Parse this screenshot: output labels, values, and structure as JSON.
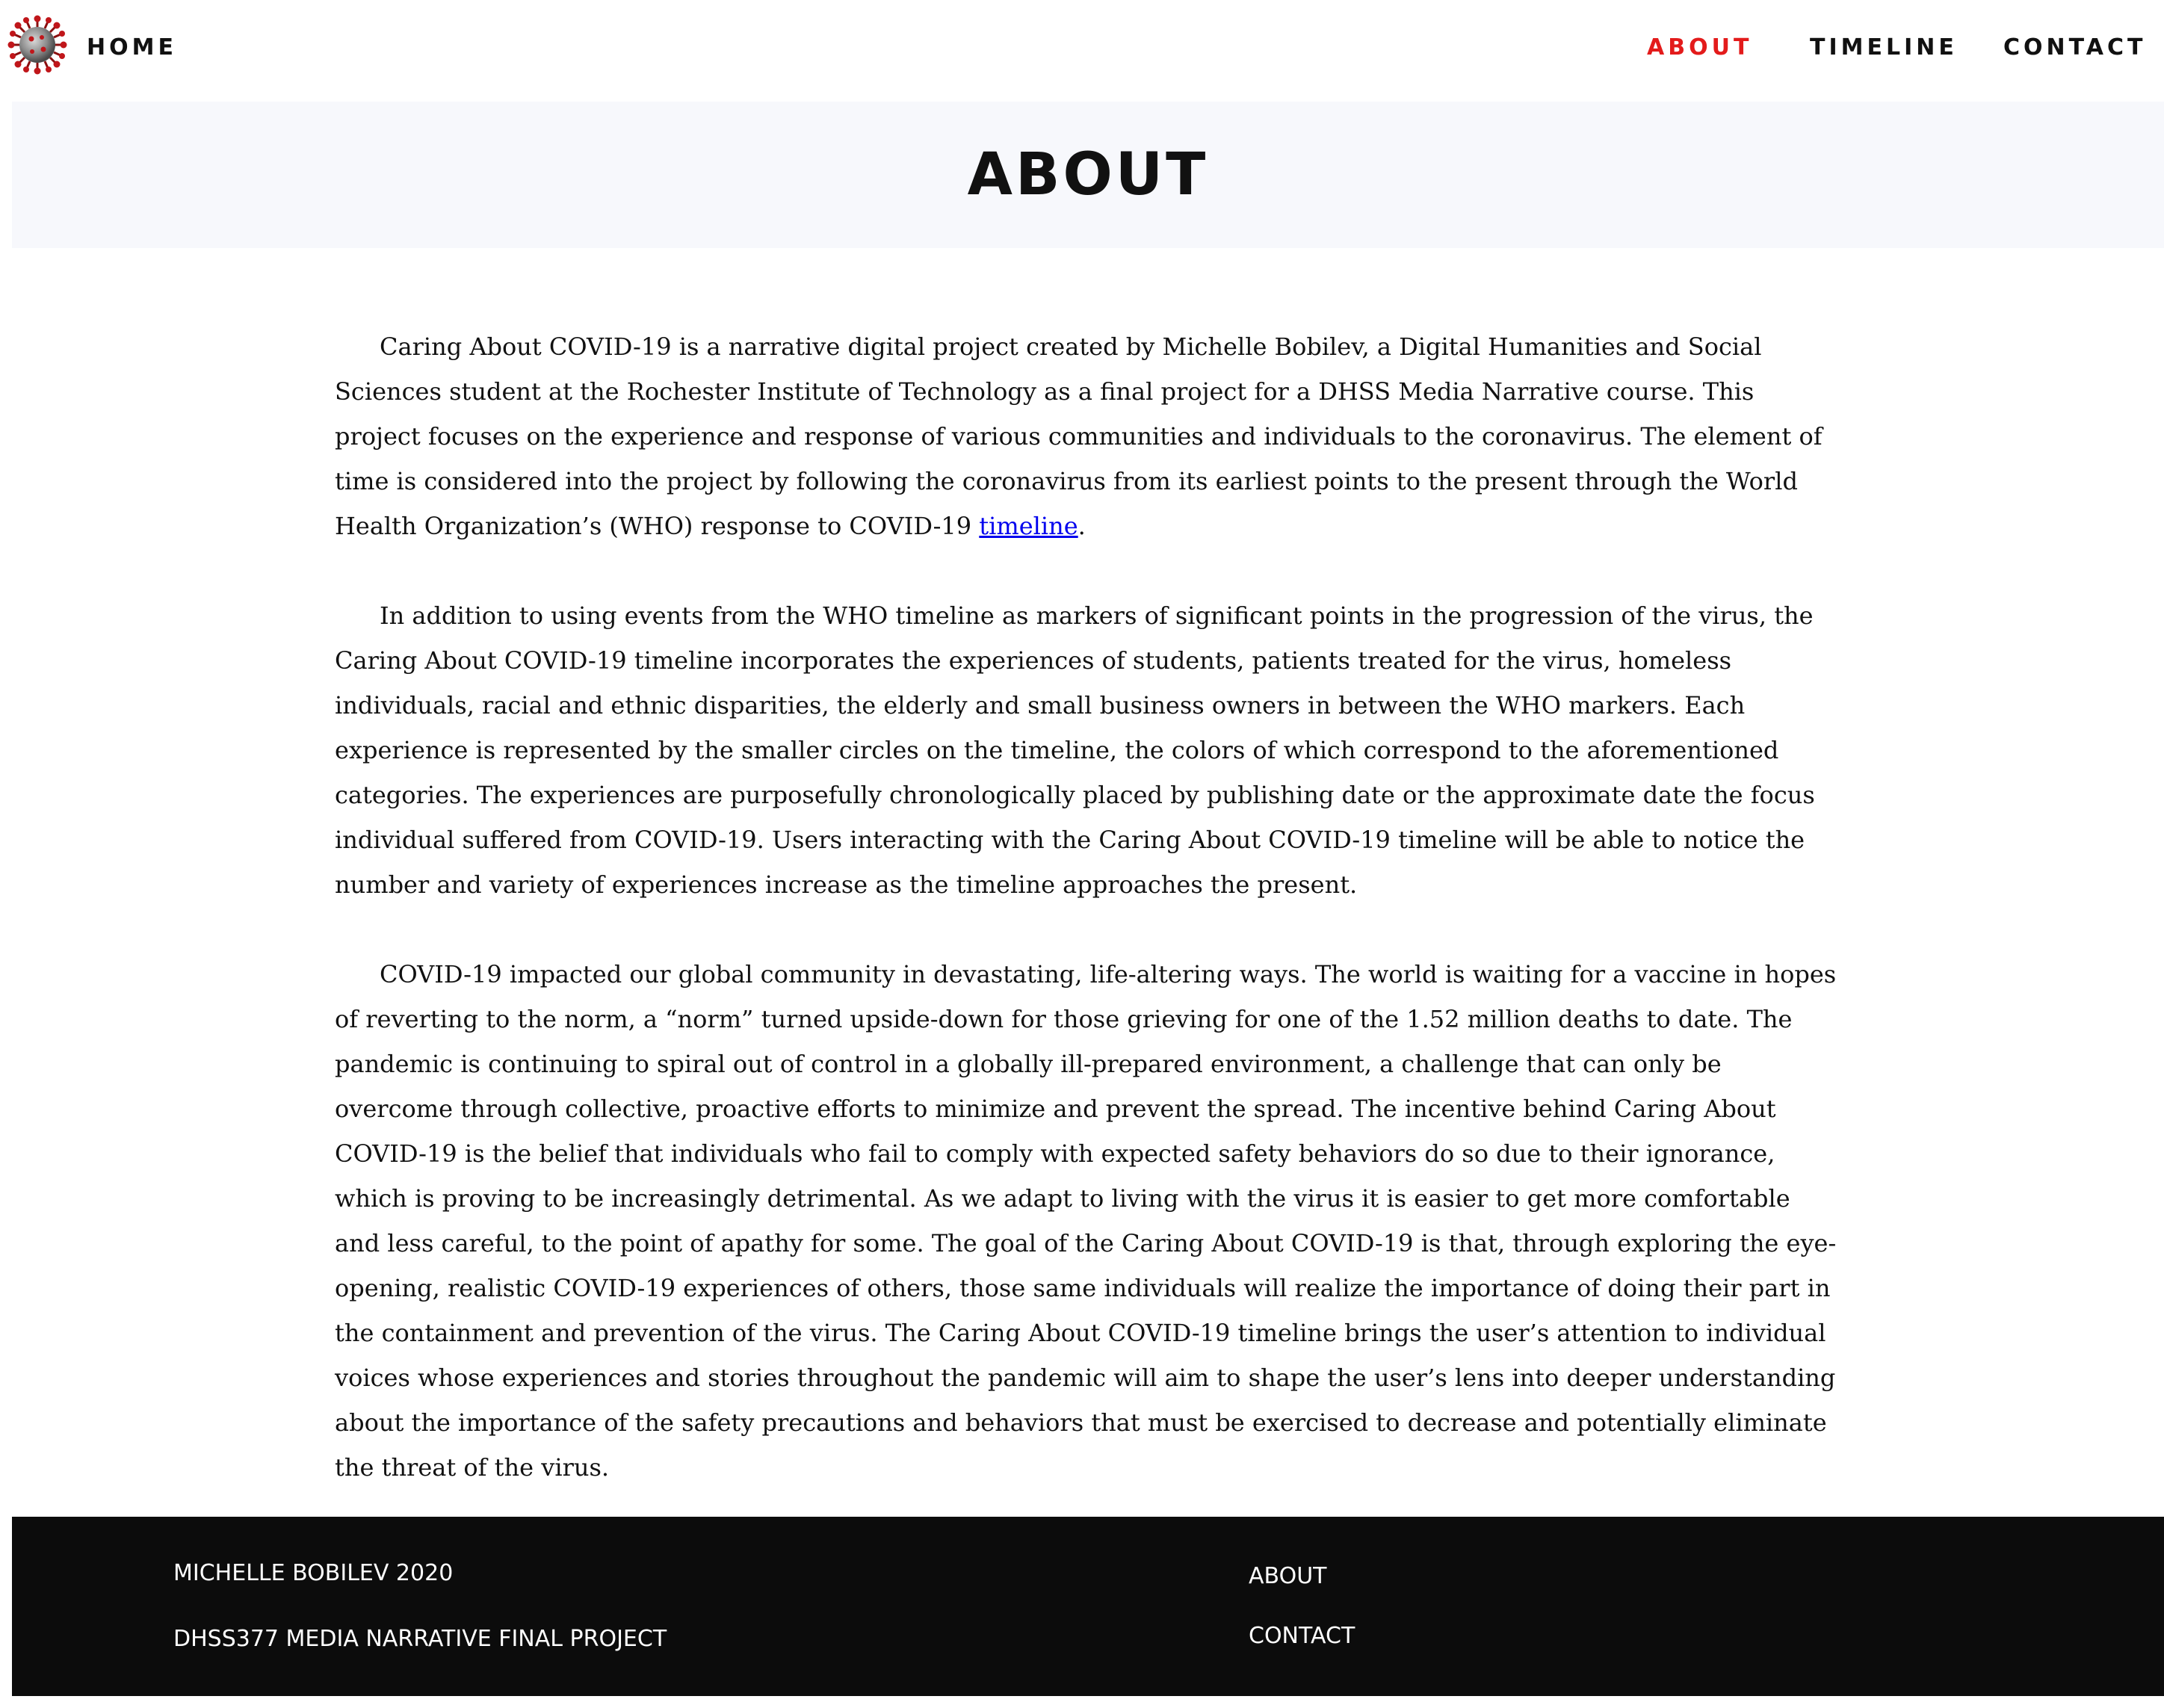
{
  "nav": {
    "home_label": "HOME",
    "about_label": "ABOUT",
    "timeline_label": "TIMELINE",
    "contact_label": "CONTACT",
    "logo_icon": "coronavirus-logo-icon",
    "active_color": "#e31b1b"
  },
  "header": {
    "title": "ABOUT",
    "background_color": "#f7f8fc"
  },
  "content": {
    "paragraph1_text": "Caring About COVID-19 is a narrative digital project created by Michelle Bobilev, a Digital Humanities and Social Sciences student at the Rochester Institute of Technology as a final project for a DHSS Media Narrative course. This project focuses on the experience and response of various communities and individuals to the coronavirus. The element of time is considered into the project by following the coronavirus from its earliest points to the present through the World Health Organization’s (WHO) response to COVID-19 ",
    "paragraph1_link": "timeline",
    "paragraph1_end": ".",
    "paragraph2": "In addition to using events from the WHO timeline as markers of significant points in the progression of the virus, the Caring About COVID-19 timeline incorporates the experiences of students, patients treated for the virus, homeless individuals, racial and ethnic disparities, the elderly and small business owners in between the WHO markers. Each experience is represented by the smaller circles on the timeline, the colors of which correspond to the aforementioned categories. The experiences are purposefully chronologically placed by publishing date or the approximate date the focus individual suffered from COVID-19. Users interacting with the Caring About COVID-19 timeline will be able to notice the number and variety of experiences increase as the timeline approaches the present.",
    "paragraph3": "COVID-19 impacted our global community in devastating, life-altering ways. The world is waiting for a vaccine in hopes of reverting to the norm, a “norm” turned upside-down for those grieving for one of the 1.52 million deaths to date. The pandemic is continuing to spiral out of control in a globally ill-prepared environment, a challenge that can only be overcome through collective, proactive efforts to minimize and prevent the spread. The incentive behind Caring About COVID-19 is the belief that individuals who fail to comply with expected safety behaviors do so due to their ignorance, which is proving to be increasingly detrimental. As we adapt to living with the virus it is easier to get more comfortable and less careful, to the point of apathy for some. The goal of the Caring About COVID-19 is that, through exploring the eye-opening, realistic COVID-19 experiences of others, those same individuals will realize the importance of doing their part in the containment and prevention of the virus. The Caring About COVID-19 timeline brings the user’s attention to individual voices whose experiences and stories throughout the pandemic will aim to shape the user’s lens into deeper understanding about the importance of the safety precautions and behaviors that must be exercised to decrease and potentially eliminate the threat of the virus.",
    "link_color": "#0000ee"
  },
  "footer": {
    "name": "MICHELLE BOBILEV 2020",
    "project": "DHSS377 MEDIA NARRATIVE FINAL PROJECT",
    "about_label": "ABOUT",
    "contact_label": "CONTACT",
    "background_color": "#0c0c0c"
  }
}
